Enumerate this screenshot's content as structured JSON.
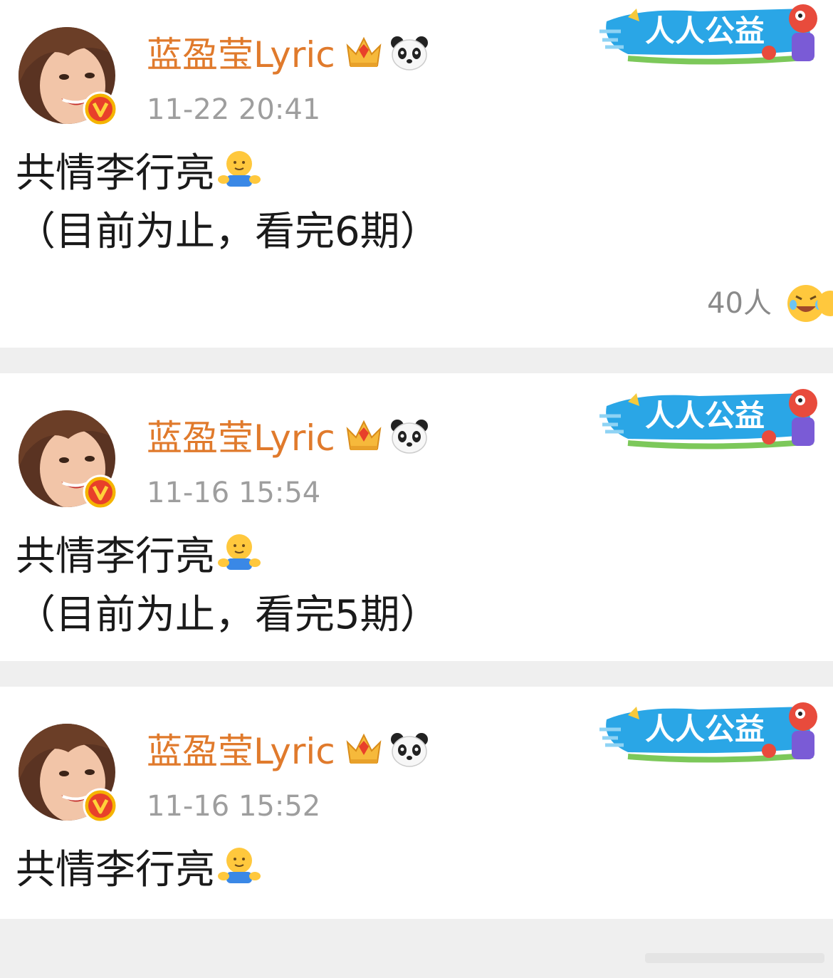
{
  "posts": [
    {
      "author": "蓝盈莹Lyric",
      "time": "11-22 20:41",
      "banner_text": "人人公益",
      "lines": [
        "共情李行亮",
        "（目前为止，看完6期）"
      ],
      "reaction_count": "40人"
    },
    {
      "author": "蓝盈莹Lyric",
      "time": "11-16 15:54",
      "banner_text": "人人公益",
      "lines": [
        "共情李行亮",
        "（目前为止，看完5期）"
      ]
    },
    {
      "author": "蓝盈莹Lyric",
      "time": "11-16 15:52",
      "banner_text": "人人公益",
      "lines": [
        "共情李行亮"
      ]
    }
  ],
  "icons": {
    "verified": "verified-v-icon",
    "vip": "crown-icon",
    "badge": "panda-icon",
    "inline_emoji": "hug-emoji-icon",
    "reaction": "laugh-cry-emoji-icon"
  },
  "colors": {
    "author": "#e07a2c",
    "time": "#9e9e9e",
    "text": "#1a1a1a",
    "separator": "#efefef",
    "banner": "#2aa6e6",
    "verified": "#f5b400"
  }
}
